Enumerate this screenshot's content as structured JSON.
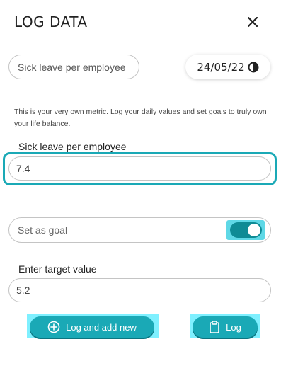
{
  "dialog": {
    "title": "LOG DATA",
    "close_icon": "close-icon"
  },
  "metric": {
    "name": "Sick leave per employee",
    "date": "24/05/22",
    "date_icon": "half-moon-icon"
  },
  "info_text": "This is your very own metric. Log your daily values and set goals to truly own your life balance.",
  "value_field": {
    "label": "Sick leave per employee",
    "value": "7.4"
  },
  "goal": {
    "label": "Set as goal",
    "enabled": true
  },
  "target_field": {
    "label": "Enter target value",
    "value": "5.2"
  },
  "buttons": {
    "log_and_add_new": "Log and add new",
    "log_and_add_new_icon": "plus-circle-icon",
    "log": "Log",
    "log_icon": "clipboard-icon"
  },
  "colors": {
    "accent": "#1aa9b6",
    "toggle_on": "#0e8b95",
    "highlight": "#7ff0ff"
  }
}
